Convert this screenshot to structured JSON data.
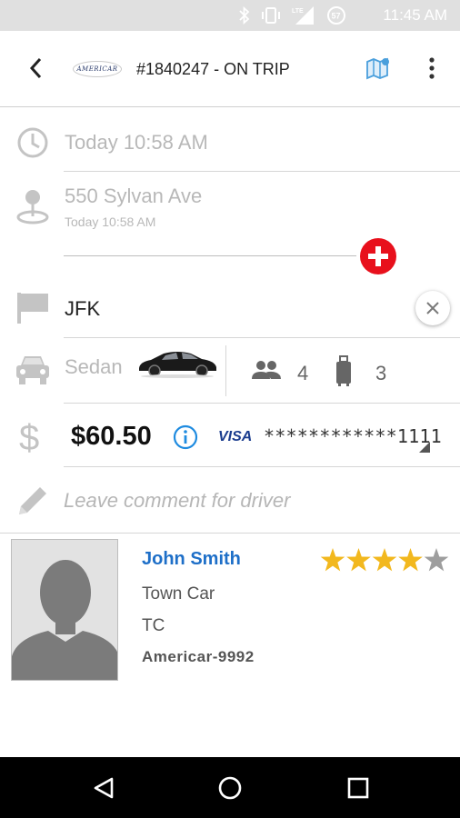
{
  "status_bar": {
    "time": "11:45 AM",
    "network": "LTE",
    "battery": "57"
  },
  "app_bar": {
    "logo_text": "AMERICAR",
    "title": "#1840247 - ON TRIP"
  },
  "pickup_time": "Today 10:58 AM",
  "pickup": {
    "address": "550 Sylvan Ave",
    "time": "Today 10:58 AM"
  },
  "destination": "JFK",
  "vehicle": {
    "type": "Sedan",
    "passengers": "4",
    "luggage": "3"
  },
  "payment": {
    "price": "$60.50",
    "card_brand": "VISA",
    "card_number": "************1111"
  },
  "comment_placeholder": "Leave comment for driver",
  "driver": {
    "name": "John Smith",
    "car": "Town Car",
    "class": "TC",
    "id": "Americar-9992",
    "rating": 4,
    "rating_max": 5
  },
  "colors": {
    "accent_blue": "#1e6fc8",
    "add_red": "#e8101c",
    "star_gold": "#f2b81e",
    "star_empty": "#9e9e9e"
  }
}
